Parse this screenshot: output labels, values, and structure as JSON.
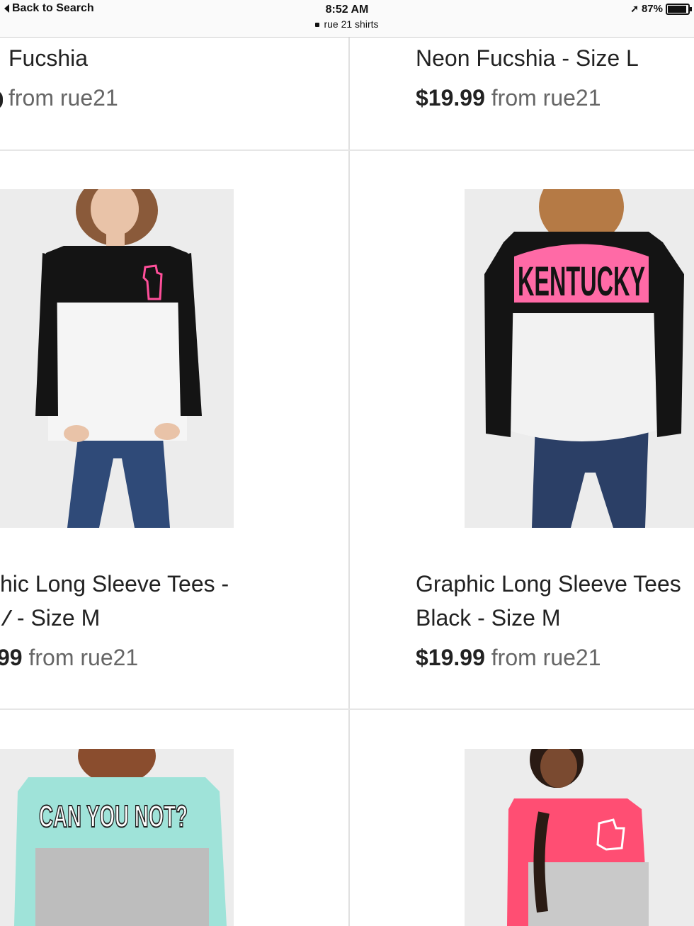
{
  "status_bar": {
    "back_label": "Back to Search",
    "time": "8:52 AM",
    "page_title": "rue 21 shirts",
    "battery": "87%",
    "battery_level": 0.87
  },
  "products": {
    "top_left": {
      "title": "Fucshia",
      "price": "",
      "from": "from rue21"
    },
    "top_right": {
      "title": "Neon Fucshia - Size L",
      "price": "$19.99",
      "from": "from rue21"
    },
    "mid_left": {
      "title_line1": "hic Long Sleeve Tees -",
      "title_line2": " - Size M",
      "price": "99",
      "from": "from rue21",
      "shirt_graphic": "state-outline-icon",
      "colors": {
        "top": "#141414",
        "bottom": "#f5f5f5",
        "accent": "#ff4f9a"
      }
    },
    "mid_right": {
      "title_line1": "Graphic Long Sleeve Tees",
      "title_line2": "Black - Size M",
      "price": "$19.99",
      "from": "from rue21",
      "shirt_text": "KENTUCKY",
      "colors": {
        "top": "#141414",
        "bottom": "#f2f2f2",
        "accent": "#ff6aa6"
      }
    },
    "bottom_left": {
      "shirt_text": "CAN YOU NOT?",
      "colors": {
        "top": "#9fe3d9",
        "bottom": "#bdbdbd",
        "accent": "#222222"
      }
    },
    "bottom_right": {
      "shirt_graphic": "state-outline-icon",
      "colors": {
        "top": "#ff4e73",
        "bottom": "#c9c9c9",
        "accent": "#ffffff"
      }
    }
  }
}
